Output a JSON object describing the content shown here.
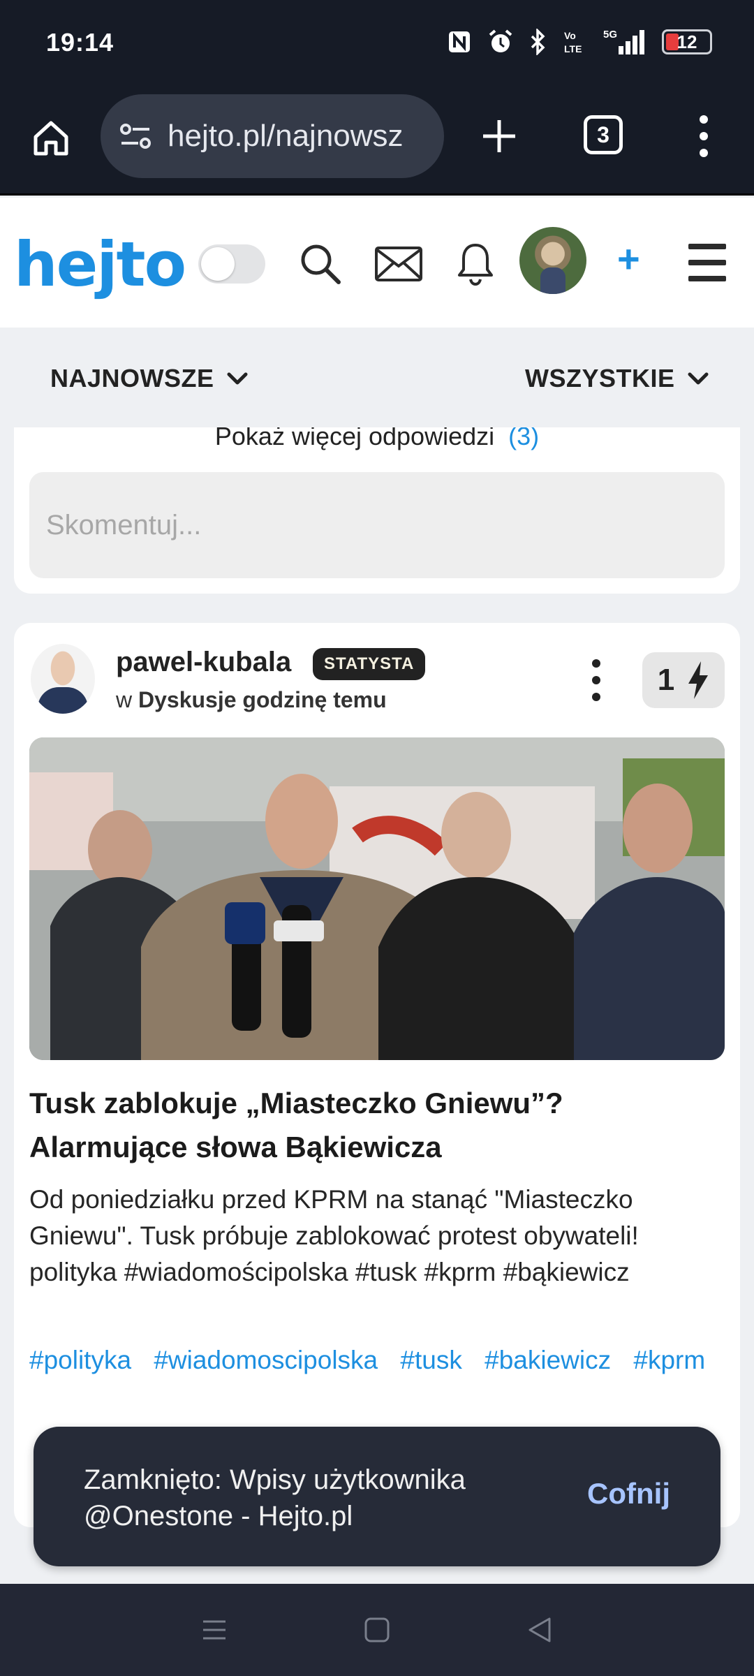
{
  "status_bar": {
    "time": "19:14",
    "battery": "12",
    "icons": [
      "nfc-icon",
      "alarm-icon",
      "bluetooth-icon",
      "volte-icon",
      "signal-5g-icon",
      "battery-icon"
    ]
  },
  "browser": {
    "url": "hejto.pl/najnowsz",
    "tab_count": "3"
  },
  "site": {
    "logo": "hejto",
    "accent_color": "#1d8fe0"
  },
  "filters": {
    "sort": "NAJNOWSZE",
    "scope": "WSZYSTKIE"
  },
  "prev_card": {
    "more_replies": "Pokaż więcej odpowiedzi",
    "more_replies_count": "(3)",
    "comment_placeholder": "Skomentuj..."
  },
  "post": {
    "author": "pawel-kubala",
    "rank": "STATYSTA",
    "meta_prefix": "w",
    "community": "Dyskusje",
    "time_ago": "godzinę temu",
    "votes": "1",
    "title": "Tusk zablokuje „Miasteczko Gniewu”? Alarmujące słowa Bąkiewicza",
    "body": "Od poniedziałku przed KPRM na stanąć \"Miasteczko Gniewu\". Tusk próbuje zablokować protest obywateli! polityka #wiadomościpolska #tusk #kprm #bąkiewicz",
    "tags": [
      "#polityka",
      "#wiadomoscipolska",
      "#tusk",
      "#bakiewicz",
      "#kprm"
    ]
  },
  "snackbar": {
    "message": "Zamknięto: Wpisy użytkownika @Onestone - Hejto.pl",
    "action": "Cofnij"
  }
}
